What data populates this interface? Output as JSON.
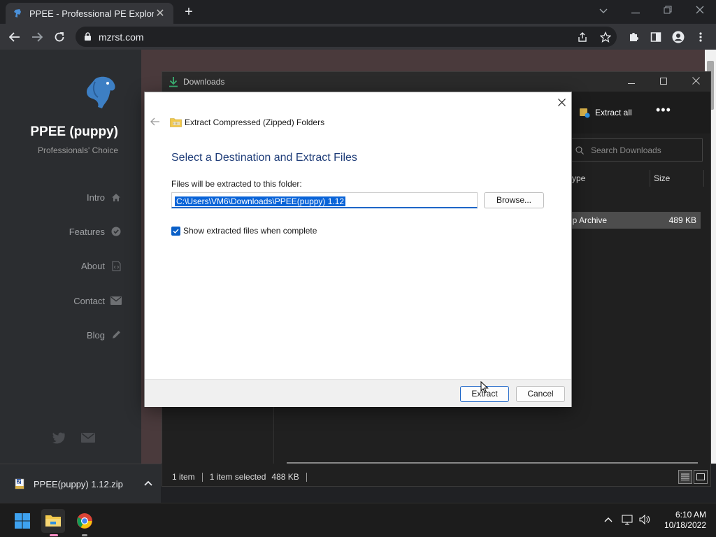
{
  "browser": {
    "tab_title": "PPEE - Professional PE Explorer",
    "tab_close": "✕",
    "new_tab": "+",
    "url": "mzrst.com"
  },
  "website": {
    "brand": "PPEE (puppy)",
    "tagline": "Professionals' Choice",
    "nav": [
      {
        "label": "Intro",
        "icon": "home-icon"
      },
      {
        "label": "Features",
        "icon": "check-circle-icon"
      },
      {
        "label": "About",
        "icon": "code-file-icon"
      },
      {
        "label": "Contact",
        "icon": "envelope-icon"
      },
      {
        "label": "Blog",
        "icon": "pencil-icon"
      }
    ]
  },
  "explorer": {
    "title": "Downloads",
    "extract_all": "Extract all",
    "more": "•••",
    "search_placeholder": "Search Downloads",
    "col_type": "ype",
    "col_size": "Size",
    "row_type": "ip Archive",
    "row_size": "489 KB",
    "status_items": "1 item",
    "status_selected": "1 item selected",
    "status_size": "488 KB"
  },
  "dialog": {
    "header": "Extract Compressed (Zipped) Folders",
    "heading": "Select a Destination and Extract Files",
    "label": "Files will be extracted to this folder:",
    "path": "C:\\Users\\VM6\\Downloads\\PPEE(puppy) 1.12",
    "browse": "Browse...",
    "checkbox_label": "Show extracted files when complete",
    "checkbox_checked": true,
    "extract": "Extract",
    "cancel": "Cancel"
  },
  "download_shelf": {
    "filename": "PPEE(puppy) 1.12.zip"
  },
  "taskbar": {
    "time": "6:10 AM",
    "date": "10/18/2022"
  },
  "colors": {
    "accent": "#0a64d8",
    "heading": "#1e3c78",
    "logo": "#3d7fc4"
  }
}
